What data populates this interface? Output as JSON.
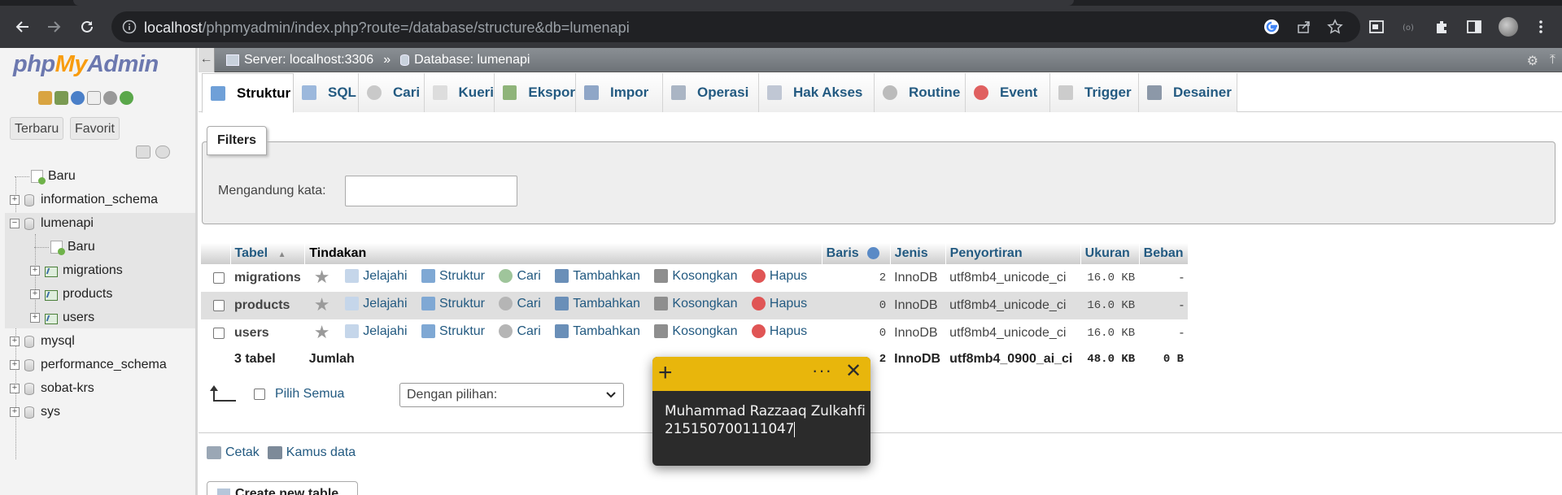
{
  "browser": {
    "url_host": "localhost",
    "url_path": "/phpmyadmin/index.php?route=/database/structure&db=lumenapi",
    "colors": {
      "frame": "#35363a",
      "omnibox": "#202124"
    }
  },
  "logo": {
    "php": "php",
    "my": "My",
    "admin": "Admin"
  },
  "nav": {
    "tabs": [
      "Terbaru",
      "Favorit"
    ],
    "new": "Baru",
    "databases": [
      "information_schema",
      "lumenapi",
      "mysql",
      "performance_schema",
      "sobat-krs",
      "sys"
    ],
    "lumenapi_children": {
      "new": "Baru",
      "tables": [
        "migrations",
        "products",
        "users"
      ]
    }
  },
  "breadcrumb": {
    "server": "Server: localhost:3306",
    "sep": "»",
    "database": "Database: lumenapi"
  },
  "menu": [
    "Struktur",
    "SQL",
    "Cari",
    "Kueri",
    "Ekspor",
    "Impor",
    "Operasi",
    "Hak Akses",
    "Routine",
    "Event",
    "Trigger",
    "Desainer"
  ],
  "filters": {
    "legend": "Filters",
    "label": "Mengandung kata:",
    "value": ""
  },
  "table": {
    "headers": {
      "table": "Tabel",
      "sort": "▲",
      "actions": "Tindakan",
      "rows": "Baris",
      "type": "Jenis",
      "collation": "Penyortiran",
      "size": "Ukuran",
      "overhead": "Beban"
    },
    "actions": [
      "Jelajahi",
      "Struktur",
      "Cari",
      "Tambahkan",
      "Kosongkan",
      "Hapus"
    ],
    "rows": [
      {
        "name": "migrations",
        "rows": "2",
        "type": "InnoDB",
        "collation": "utf8mb4_unicode_ci",
        "size": "16.0 KB",
        "overhead": "-"
      },
      {
        "name": "products",
        "rows": "0",
        "type": "InnoDB",
        "collation": "utf8mb4_unicode_ci",
        "size": "16.0 KB",
        "overhead": "-"
      },
      {
        "name": "users",
        "rows": "0",
        "type": "InnoDB",
        "collation": "utf8mb4_unicode_ci",
        "size": "16.0 KB",
        "overhead": "-"
      }
    ],
    "footer": {
      "count": "3 tabel",
      "label": "Jumlah",
      "rows": "2",
      "type": "InnoDB",
      "collation": "utf8mb4_0900_ai_ci",
      "size": "48.0 KB",
      "overhead": "0 B"
    }
  },
  "bulk": {
    "select_all": "Pilih Semua",
    "with_selected": "Dengan pilihan:"
  },
  "links": {
    "print": "Cetak",
    "dictionary": "Kamus data"
  },
  "create": {
    "title": "Create new table"
  },
  "note": {
    "line1": "Muhammad Razzaaq Zulkahfi",
    "line2": "215150700111047",
    "color": "#e8b60c"
  }
}
